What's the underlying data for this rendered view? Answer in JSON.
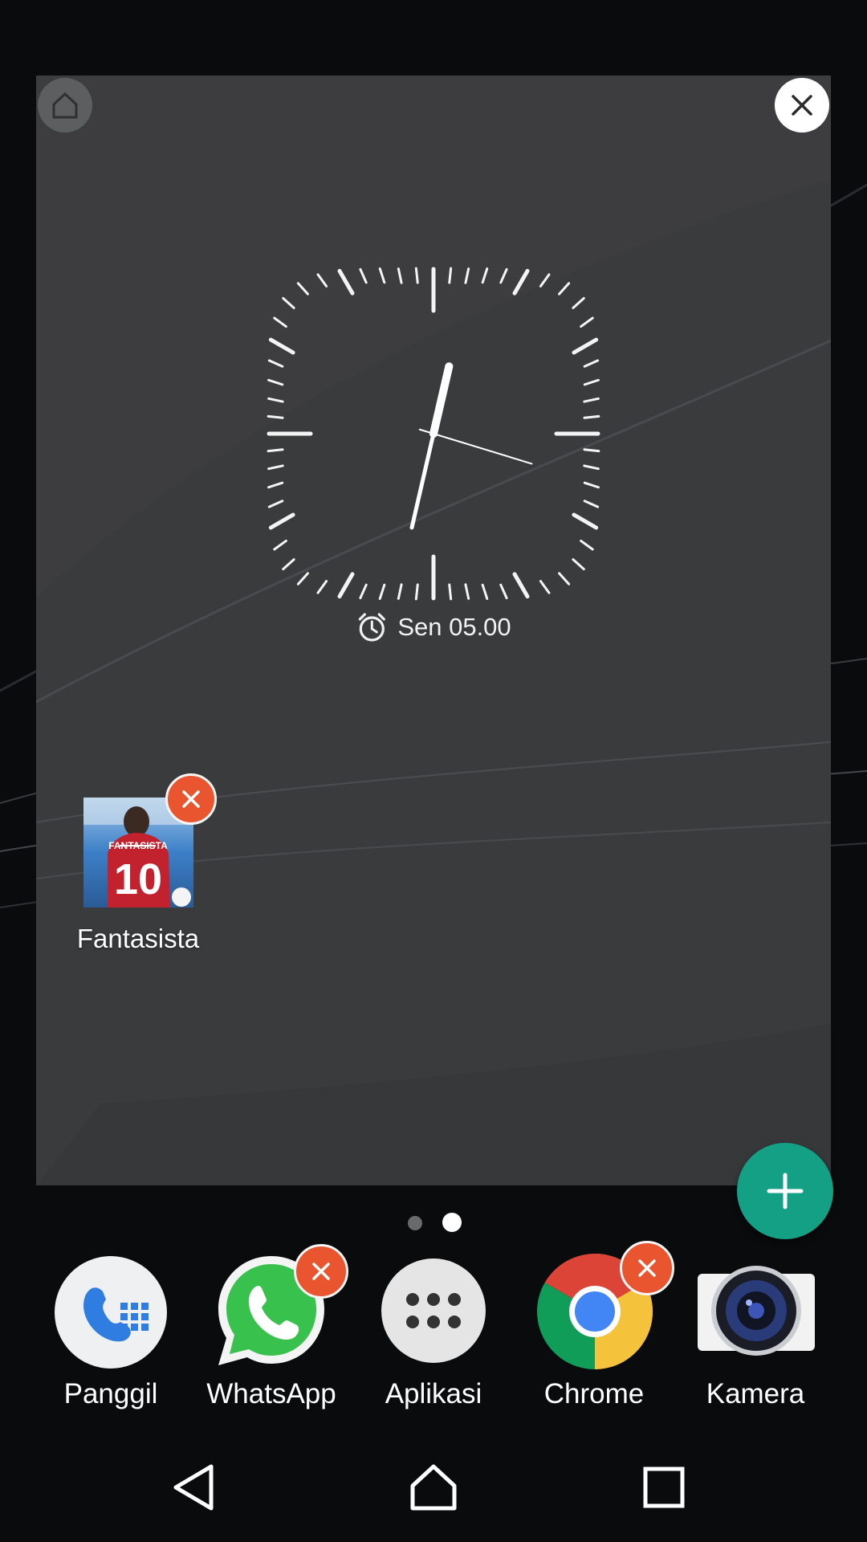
{
  "clock": {
    "alarm_icon": "alarm-clock-icon",
    "alarm_text": "Sen 05.00"
  },
  "editor": {
    "home_icon": "home-outline-icon",
    "close_icon": "close-icon",
    "add_icon": "plus-icon"
  },
  "shortcuts": [
    {
      "label": "Fantasista",
      "remove_icon": "remove-x-icon"
    }
  ],
  "page_indicator": {
    "count": 2,
    "active": 2
  },
  "dock": [
    {
      "label": "Panggil",
      "icon": "phone-dialer-icon",
      "removable": false
    },
    {
      "label": "WhatsApp",
      "icon": "whatsapp-icon",
      "removable": true
    },
    {
      "label": "Aplikasi",
      "icon": "app-drawer-icon",
      "removable": false
    },
    {
      "label": "Chrome",
      "icon": "chrome-icon",
      "removable": true
    },
    {
      "label": "Kamera",
      "icon": "camera-icon",
      "removable": false
    }
  ],
  "navbar": {
    "back_icon": "back-triangle-icon",
    "home_icon": "home-icon",
    "recents_icon": "recents-square-icon"
  },
  "colors": {
    "panel": "#3a3b3d",
    "remove_badge": "#e8552f",
    "fab": "#14a085",
    "background": "#0a0b0d"
  }
}
